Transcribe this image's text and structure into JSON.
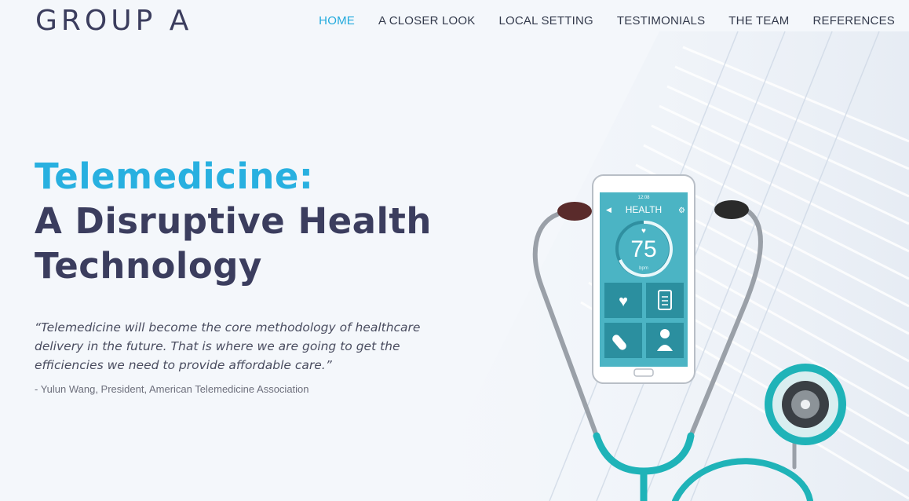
{
  "brand": {
    "logo": "GROUP A"
  },
  "nav": {
    "items": [
      {
        "label": "HOME",
        "active": true
      },
      {
        "label": "A CLOSER LOOK",
        "active": false
      },
      {
        "label": "LOCAL SETTING",
        "active": false
      },
      {
        "label": "TESTIMONIALS",
        "active": false
      },
      {
        "label": "THE TEAM",
        "active": false
      },
      {
        "label": "REFERENCES",
        "active": false
      }
    ]
  },
  "hero": {
    "title_line1": "Telemedicine:",
    "title_line2": "A Disruptive Health",
    "title_line3": "Technology",
    "quote": "“Telemedicine will become the core methodology of healthcare delivery in the future. That is where we are going to get the efficiencies we need to provide affordable care.”",
    "citation": "- Yulun Wang, President, American Telemedicine Association"
  },
  "phone": {
    "time": "12:08",
    "app_title": "HEALTH",
    "heart_rate": "75",
    "unit": "bpm"
  },
  "colors": {
    "accent": "#28b0e0",
    "heading": "#3b3d5e",
    "teal": "#1fb3b8",
    "screen": "#4bb4c4"
  }
}
